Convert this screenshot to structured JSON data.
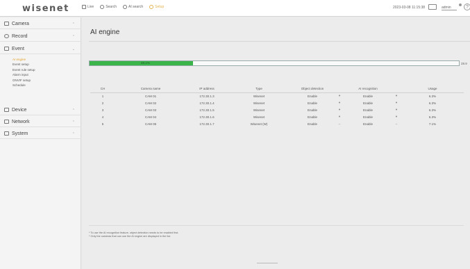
{
  "header": {
    "logo": "wisenet",
    "nav": [
      {
        "label": "Live",
        "icon": "monitor-icon"
      },
      {
        "label": "Search",
        "icon": "search-icon"
      },
      {
        "label": "AI search",
        "icon": "ai-search-icon"
      },
      {
        "label": "Setup",
        "icon": "gear-icon",
        "active": true
      }
    ],
    "datetime": "2023-03-08 11:15:38",
    "user": "admin",
    "help": "?"
  },
  "sidebar": {
    "items": [
      {
        "label": "Camera",
        "icon": "camera-icon",
        "expanded": false
      },
      {
        "label": "Record",
        "icon": "record-icon",
        "expanded": false
      },
      {
        "label": "Event",
        "icon": "event-icon",
        "expanded": true
      },
      {
        "label": "Device",
        "icon": "device-icon",
        "expanded": false
      },
      {
        "label": "Network",
        "icon": "network-icon",
        "expanded": false
      },
      {
        "label": "System",
        "icon": "system-icon",
        "expanded": false
      }
    ],
    "event_submenu": [
      "AI engine",
      "Event setup",
      "Event rule setup",
      "Alarm input",
      "ONVIF setup",
      "Schedule"
    ],
    "active_submenu": "AI engine"
  },
  "main": {
    "title": "AI engine",
    "progress": {
      "label": "28.1%",
      "fraction": 0.281,
      "right_label": "28.9"
    },
    "table": {
      "headers": [
        "CH",
        "Camera name",
        "IP address",
        "Type",
        "Object detection",
        "",
        "AI recognition",
        "",
        "Usage"
      ],
      "rows": [
        [
          "1",
          "CAM 01",
          "172.30.1.3",
          "Wisenet",
          "Enable",
          "▾",
          "Enable",
          "▾",
          "6.3%"
        ],
        [
          "2",
          "CAM 02",
          "172.30.1.4",
          "Wisenet",
          "Enable",
          "▾",
          "Enable",
          "▾",
          "6.3%"
        ],
        [
          "3",
          "CAM 03",
          "172.30.1.5",
          "Wisenet",
          "Enable",
          "▾",
          "Enable",
          "▾",
          "6.3%"
        ],
        [
          "4",
          "CAM 04",
          "172.30.1.6",
          "Wisenet",
          "Enable",
          "▾",
          "Enable",
          "▾",
          "6.3%"
        ],
        [
          "5",
          "CAM 05",
          "172.30.1.7",
          "Wisenet (W)",
          "Enable",
          "–",
          "Enable",
          "–",
          "7.1%"
        ]
      ]
    },
    "notes": [
      "* To use the AI recognition feature, object detection needs to be enabled first.",
      "* Only the cameras that can use the AI engine are displayed in the list."
    ]
  }
}
